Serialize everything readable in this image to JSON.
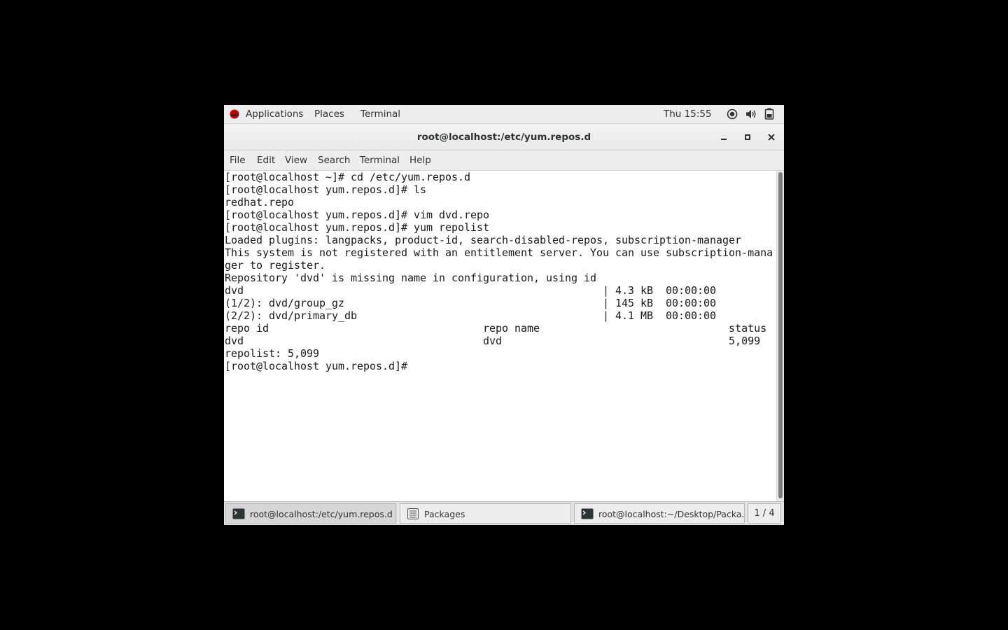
{
  "topbar": {
    "applications": "Applications",
    "places": "Places",
    "terminal": "Terminal",
    "clock": "Thu 15:55"
  },
  "window": {
    "title": "root@localhost:/etc/yum.repos.d"
  },
  "menubar": [
    "File",
    "Edit",
    "View",
    "Search",
    "Terminal",
    "Help"
  ],
  "terminal": {
    "output": "[root@localhost ~]# cd /etc/yum.repos.d\n[root@localhost yum.repos.d]# ls\nredhat.repo\n[root@localhost yum.repos.d]# vim dvd.repo\n[root@localhost yum.repos.d]# yum repolist\nLoaded plugins: langpacks, product-id, search-disabled-repos, subscription-manager\nThis system is not registered with an entitlement server. You can use subscription-mana\nger to register.\nRepository 'dvd' is missing name in configuration, using id\ndvd                                                         | 4.3 kB  00:00:00\n(1/2): dvd/group_gz                                         | 145 kB  00:00:00\n(2/2): dvd/primary_db                                       | 4.1 MB  00:00:00\nrepo id                                  repo name                              status\ndvd                                      dvd                                    5,099\nrepolist: 5,099\n[root@localhost yum.repos.d]# "
  },
  "taskbar": {
    "tasks": [
      {
        "label": "root@localhost:/etc/yum.repos.d",
        "icon": "terminal-icon"
      },
      {
        "label": "Packages",
        "icon": "file-manager-icon"
      },
      {
        "label": "root@localhost:~/Desktop/Packa...",
        "icon": "terminal-icon"
      }
    ],
    "workspace": "1 / 4"
  }
}
